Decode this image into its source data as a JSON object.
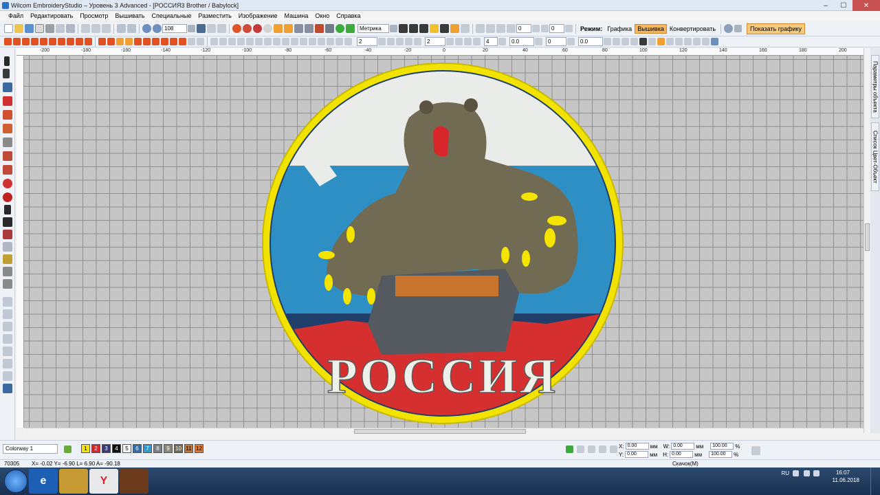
{
  "window": {
    "title": "Wilcom EmbroideryStudio – Уровень 3 Advanced - [РОССИЯ3        Brother / Babylock]",
    "min": "–",
    "max": "☐",
    "close": "✕"
  },
  "menu": [
    "Файл",
    "Редактировать",
    "Просмотр",
    "Вышивать",
    "Специальные",
    "Разместить",
    "Изображение",
    "Машина",
    "Окно",
    "Справка"
  ],
  "toolbar1": {
    "zoom_value": "108",
    "units_value": "Метрика",
    "stitch_count_a": "0",
    "stitch_count_b": "0",
    "mode_label": "Режим:",
    "mode_graphics": "Графика",
    "mode_embroidery": "Вышивка",
    "mode_convert": "Конвертировать",
    "show_graphics": "Показать графику"
  },
  "toolbar2": {
    "field_a": "2",
    "field_b": "2",
    "field_c": "4",
    "field_d": "0.0",
    "field_e": "0",
    "field_f": "0.0"
  },
  "ruler": {
    "h_labels": [
      "200",
      "180",
      "160",
      "140",
      "120",
      "100",
      "80",
      "60",
      "40",
      "20",
      "0",
      "20",
      "40",
      "60",
      "80",
      "100",
      "120",
      "140",
      "160",
      "180",
      "200"
    ],
    "h_negative_marker": "-"
  },
  "design": {
    "text": "РОССИЯ",
    "colors": {
      "border": "#f2e200",
      "white": "#e9ece8",
      "blue": "#2e8fc4",
      "red": "#d62f2f",
      "bear": "#726b53"
    }
  },
  "side_tabs": {
    "object_props": "Параметры объекта",
    "color_list": "Список Цвет-Объект"
  },
  "bottombar": {
    "colorway": "Colorway 1",
    "swatches": [
      {
        "n": "1",
        "c": "#f4e400"
      },
      {
        "n": "2",
        "c": "#d8262b"
      },
      {
        "n": "3",
        "c": "#3a3a7a"
      },
      {
        "n": "4",
        "c": "#111111"
      },
      {
        "n": "5",
        "c": "#f4f4f4"
      },
      {
        "n": "6",
        "c": "#2f6ea8"
      },
      {
        "n": "7",
        "c": "#2f9ad0"
      },
      {
        "n": "8",
        "c": "#7a7e86"
      },
      {
        "n": "9",
        "c": "#8b8678"
      },
      {
        "n": "10",
        "c": "#726b53"
      },
      {
        "n": "11",
        "c": "#c8742c"
      },
      {
        "n": "12",
        "c": "#e07830"
      }
    ],
    "x_label": "X:",
    "y_label": "Y:",
    "w_label": "W:",
    "h_label": "H:",
    "x_value": "0.00",
    "y_value": "0.00",
    "w_value": "0.00",
    "h_value": "0.00",
    "unit": "мм",
    "w_pct": "100.00",
    "h_pct": "100.00",
    "pct": "%"
  },
  "status": {
    "stitches": "70305",
    "readout": "X=  -0.02 Y=  -6.90 L=   6.90 A= -90.18",
    "right": "Скачок(М)"
  },
  "taskbar": {
    "lang": "RU",
    "time": "16:07",
    "date": "11.06.2018"
  }
}
